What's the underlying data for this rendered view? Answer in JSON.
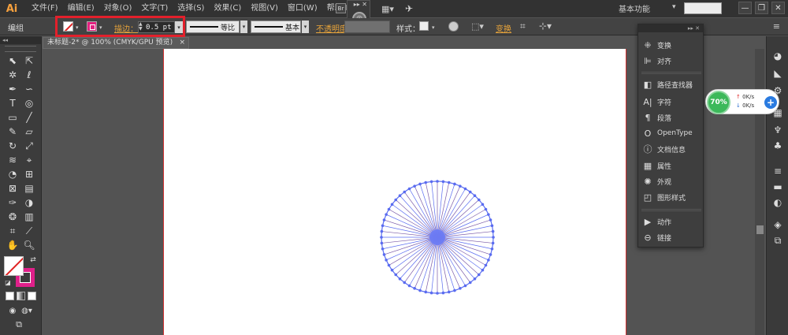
{
  "app": {
    "logo": "Ai",
    "menu": [
      "文件(F)",
      "编辑(E)",
      "对象(O)",
      "文字(T)",
      "选择(S)",
      "效果(C)",
      "视图(V)",
      "窗口(W)",
      "帮助(H)"
    ],
    "bridge_label": "Br",
    "workspace": "基本功能",
    "window_controls": [
      "—",
      "❐",
      "✕"
    ]
  },
  "control_bar": {
    "selection_label": "编组",
    "stroke_label": "描边：",
    "stroke_value": "0.5 pt",
    "variable_width": "等比",
    "brush": "基本",
    "opacity_label": "不透明度",
    "style_label": "样式：",
    "transform_label": "变换"
  },
  "document": {
    "tab_title": "未标题-2* @ 100% (CMYK/GPU 预览)",
    "tab_close": "×"
  },
  "dock_panel": {
    "items": [
      {
        "label": "变换",
        "icon": "transform-icon",
        "glyph": "⁜"
      },
      {
        "label": "对齐",
        "icon": "align-icon",
        "glyph": "⊫"
      },
      {
        "label": "路径查找器",
        "icon": "pathfinder-icon",
        "glyph": "◧"
      },
      {
        "label": "字符",
        "icon": "character-icon",
        "glyph": "A|"
      },
      {
        "label": "段落",
        "icon": "paragraph-icon",
        "glyph": "¶"
      },
      {
        "label": "OpenType",
        "icon": "opentype-icon",
        "glyph": "O"
      },
      {
        "label": "文档信息",
        "icon": "document-info-icon",
        "glyph": "ⓘ"
      },
      {
        "label": "属性",
        "icon": "attributes-icon",
        "glyph": "▦"
      },
      {
        "label": "外观",
        "icon": "appearance-icon",
        "glyph": "✺"
      },
      {
        "label": "图形样式",
        "icon": "graphic-styles-icon",
        "glyph": "◰"
      },
      {
        "label": "动作",
        "icon": "actions-icon",
        "glyph": "▶"
      },
      {
        "label": "链接",
        "icon": "links-icon",
        "glyph": "⊖"
      }
    ]
  },
  "speed_widget": {
    "percent": "70%",
    "up": "0K/s",
    "down": "0K/s",
    "up_arrow": "↑",
    "down_arrow": "↓",
    "plus": "+"
  },
  "colors": {
    "accent_orange": "#e8a43a",
    "highlight_red": "#e3202b",
    "stroke_magenta": "#e0208a",
    "radial_blue": "#5a6cf0",
    "radial_line": "#7a5aa8"
  },
  "radial_figure": {
    "spokes": 60,
    "shape": "circle-of-lines"
  }
}
